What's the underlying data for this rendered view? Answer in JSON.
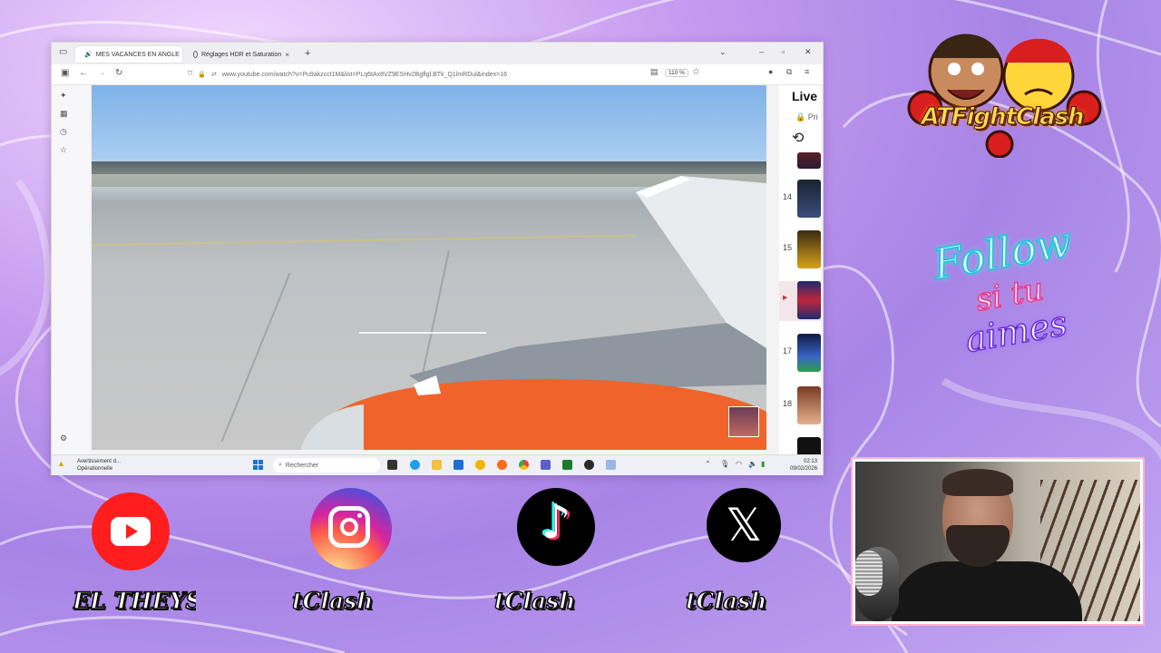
{
  "browser": {
    "tabs": [
      {
        "label": "MES VACANCES EN ANGLE",
        "close": "×"
      },
      {
        "label": "Réglages HDR et Saturation",
        "close": "×"
      }
    ],
    "new_tab": "+",
    "url": "www.youtube.com/watch?v=Pu9akzcct1M&list=PLq6tAx8VZ9ESHv2Bgflgl.BTk_Q1lmRDul&index=16",
    "zoom": "110 %"
  },
  "playlist": {
    "title": "Live",
    "privacy": "Pri",
    "items": [
      {
        "index": "14"
      },
      {
        "index": "15"
      },
      {
        "index": "▶"
      },
      {
        "index": "17"
      },
      {
        "index": "18"
      }
    ]
  },
  "taskbar": {
    "warning_title": "Avertissement d...",
    "warning_sub": "Opérationnelle",
    "search_placeholder": "Rechercher",
    "time": "02:13",
    "date": "09/02/2026"
  },
  "overlay": {
    "logo_text": "ATFightClash",
    "follow_lines": [
      "Follow",
      "si tu",
      "aimes"
    ],
    "handles": {
      "youtube": "EL THEYSS",
      "instagram": "tClash",
      "tiktok": "tClash",
      "x": "tClash"
    }
  },
  "colors": {
    "youtube": "#ff1d1d",
    "tiktok_cyan": "#25f4ee",
    "tiktok_red": "#fe2c55",
    "follow_cyan": "#28c4d9",
    "follow_pink": "#e8368d",
    "follow_purple": "#6a2cd6"
  }
}
